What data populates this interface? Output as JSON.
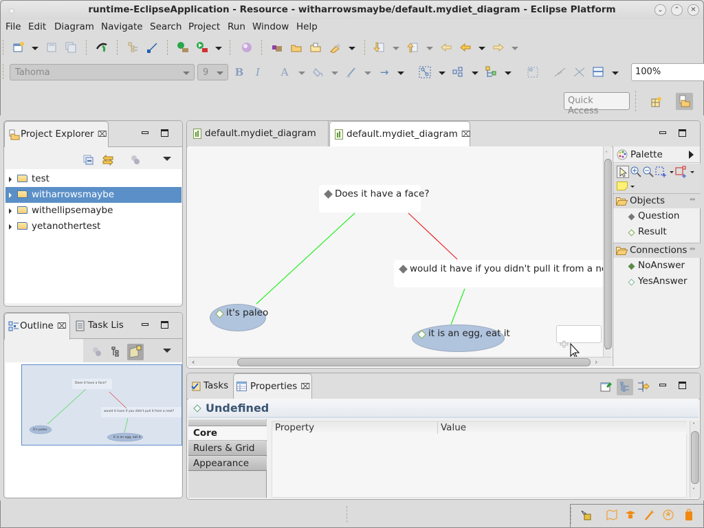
{
  "window": {
    "title": "runtime-EclipseApplication - Resource - witharrowsmaybe/default.mydiet_diagram - Eclipse Platform",
    "controls": [
      "minimize",
      "maximize",
      "close"
    ]
  },
  "menubar": {
    "items": [
      "File",
      "Edit",
      "Diagram",
      "Navigate",
      "Search",
      "Project",
      "Run",
      "Window",
      "Help"
    ]
  },
  "toolbar": {
    "font_family": "Tahoma",
    "font_size": "9",
    "bold_label": "B",
    "italic_label": "I",
    "font_color_label": "A",
    "zoom_value": "100%",
    "quick_access_placeholder": "Quick Access"
  },
  "project_explorer": {
    "tab_label": "Project Explorer",
    "items": [
      {
        "label": "test",
        "selected": false
      },
      {
        "label": "witharrowsmaybe",
        "selected": true
      },
      {
        "label": "withellipsemaybe",
        "selected": false
      },
      {
        "label": "yetanothertest",
        "selected": false
      }
    ]
  },
  "outline": {
    "tabs": [
      {
        "label": "Outline",
        "active": true
      },
      {
        "label": "Task Lis",
        "active": false
      }
    ]
  },
  "editor": {
    "tabs": [
      {
        "label": "default.mydiet_diagram",
        "active": false
      },
      {
        "label": "default.mydiet_diagram",
        "active": true
      }
    ],
    "nodes": {
      "q1": {
        "label": "Does it have a face?",
        "type": "Question"
      },
      "q2": {
        "label": "would it have if you didn't pull it from a nest?",
        "type": "Question"
      },
      "r1": {
        "label": "it's paleo",
        "type": "Result"
      },
      "r2": {
        "label": "it is an egg, eat it",
        "type": "Result"
      }
    },
    "connections": [
      {
        "from": "q1",
        "to": "r1",
        "type": "YesAnswer",
        "color": "#22dd22"
      },
      {
        "from": "q1",
        "to": "q2",
        "type": "NoAnswer",
        "color": "#dd2222"
      },
      {
        "from": "q2",
        "to": "r2",
        "type": "YesAnswer",
        "color": "#22dd22"
      }
    ]
  },
  "palette": {
    "title": "Palette",
    "drawers": [
      {
        "label": "Objects",
        "items": [
          "Question",
          "Result"
        ]
      },
      {
        "label": "Connections",
        "items": [
          "NoAnswer",
          "YesAnswer"
        ]
      }
    ]
  },
  "bottom_panel": {
    "tabs": [
      {
        "label": "Tasks",
        "active": false
      },
      {
        "label": "Properties",
        "active": true
      }
    ],
    "properties": {
      "title": "Undefined",
      "sections": [
        {
          "label": "Core",
          "active": true
        },
        {
          "label": "Rulers & Grid",
          "active": false
        },
        {
          "label": "Appearance",
          "active": false
        }
      ],
      "columns": [
        "Property",
        "Value"
      ]
    }
  },
  "colors": {
    "selection": "#5b8fc7",
    "yes_connection": "#22dd22",
    "no_connection": "#dd2222",
    "result_fill": "#b0c4de",
    "properties_title": "#3a5572"
  }
}
